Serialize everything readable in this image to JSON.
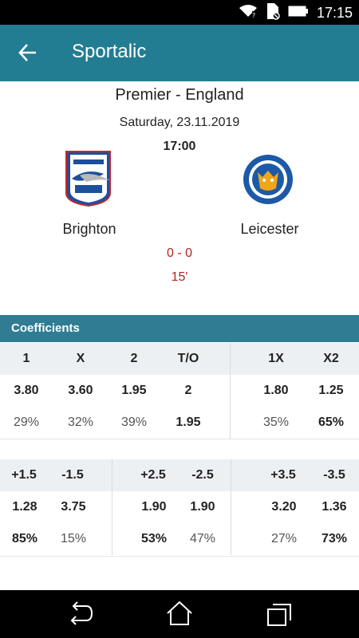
{
  "status_bar": {
    "time": "17:15",
    "icons": [
      "wifi-icon",
      "sim-icon",
      "battery-icon"
    ]
  },
  "app_bar": {
    "title": "Sportalic",
    "back_icon": "arrow-left-icon"
  },
  "match": {
    "league": "Premier - England",
    "date": "Saturday, 23.11.2019",
    "kickoff": "17:00",
    "home": {
      "name": "Brighton"
    },
    "away": {
      "name": "Leicester"
    },
    "score": "0 - 0",
    "minute": "15'"
  },
  "coefficients": {
    "title": "Coefficients",
    "main": {
      "headers": [
        "1",
        "X",
        "2",
        "T/O",
        "1X",
        "X2"
      ],
      "odds": [
        "3.80",
        "3.60",
        "1.95",
        "2",
        "1.80",
        "1.25"
      ],
      "percents": [
        "29%",
        "32%",
        "39%",
        "1.95",
        "35%",
        "65%"
      ]
    },
    "handicap": {
      "headers": [
        "+1.5",
        "-1.5",
        "+2.5",
        "-2.5",
        "+3.5",
        "-3.5"
      ],
      "odds": [
        "1.28",
        "3.75",
        "1.90",
        "1.90",
        "3.20",
        "1.36"
      ],
      "percents": [
        "85%",
        "15%",
        "53%",
        "47%",
        "27%",
        "73%"
      ]
    }
  },
  "nav": {
    "items": [
      "back-icon",
      "home-icon",
      "recents-icon"
    ]
  },
  "colors": {
    "app_bar": "#227d93",
    "header": "#2f7c93",
    "score": "#b5201e",
    "row_head": "#ecf0f2"
  }
}
